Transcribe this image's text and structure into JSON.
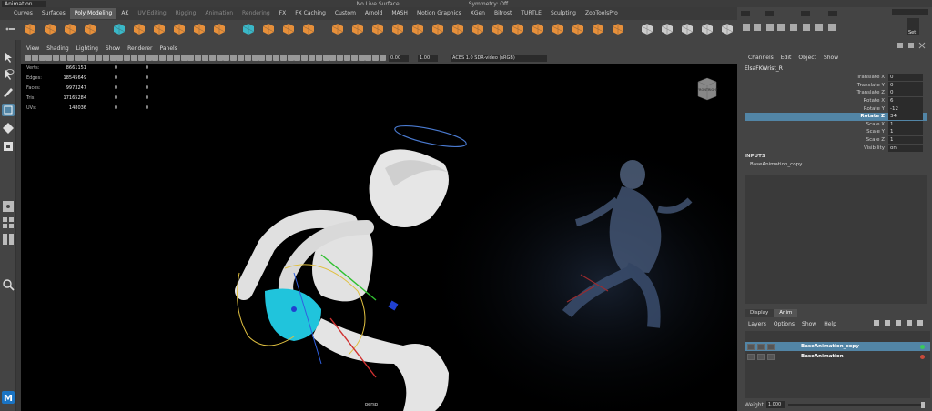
{
  "status_line": {
    "menu_set": "Animation",
    "live_surface": "No Live Surface",
    "symmetry": "Symmetry: Off"
  },
  "shelf_tabs": [
    {
      "label": "Curves",
      "active": false
    },
    {
      "label": "Surfaces",
      "active": false
    },
    {
      "label": "Poly Modeling",
      "active": true
    },
    {
      "label": "AK",
      "active": false
    },
    {
      "label": "UV Editing",
      "active": false,
      "dim": true
    },
    {
      "label": "Rigging",
      "active": false,
      "dim": true
    },
    {
      "label": "Animation",
      "active": false,
      "dim": true
    },
    {
      "label": "Rendering",
      "active": false,
      "dim": true
    },
    {
      "label": "FX",
      "active": false
    },
    {
      "label": "FX Caching",
      "active": false
    },
    {
      "label": "Custom",
      "active": false
    },
    {
      "label": "Arnold",
      "active": false
    },
    {
      "label": "MASH",
      "active": false
    },
    {
      "label": "Motion Graphics",
      "active": false
    },
    {
      "label": "XGen",
      "active": false
    },
    {
      "label": "Bifrost",
      "active": false
    },
    {
      "label": "TURTLE",
      "active": false
    },
    {
      "label": "Sculpting",
      "active": false
    },
    {
      "label": "ZooToolsPro",
      "active": false
    }
  ],
  "right_toolbar": {
    "set_label": "Set"
  },
  "viewport": {
    "menu": [
      "View",
      "Shading",
      "Lighting",
      "Show",
      "Renderer",
      "Panels"
    ],
    "field_a": "0.00",
    "field_b": "1.00",
    "color_management": "ACES 1.0 SDR-video (sRGB)",
    "camera": "persp",
    "hud": [
      {
        "label": "Verts:",
        "value": "8661151",
        "c1": "0",
        "c2": "0"
      },
      {
        "label": "Edges:",
        "value": "18545649",
        "c1": "0",
        "c2": "0"
      },
      {
        "label": "Faces:",
        "value": "9973247",
        "c1": "0",
        "c2": "0"
      },
      {
        "label": "Tris:",
        "value": "17165284",
        "c1": "0",
        "c2": "0"
      },
      {
        "label": "UVs:",
        "value": "148036",
        "c1": "0",
        "c2": "0"
      }
    ],
    "viewcube": {
      "face_a": "FRONT",
      "face_b": "RIGHT"
    }
  },
  "channel_box": {
    "menu": [
      "Channels",
      "Edit",
      "Object",
      "Show"
    ],
    "node": "ElsaFKWrist_R",
    "attributes": [
      {
        "label": "Translate X",
        "value": "0",
        "selected": false
      },
      {
        "label": "Translate Y",
        "value": "0",
        "selected": false
      },
      {
        "label": "Translate Z",
        "value": "0",
        "selected": false
      },
      {
        "label": "Rotate X",
        "value": "6",
        "selected": false
      },
      {
        "label": "Rotate Y",
        "value": "-12",
        "selected": false
      },
      {
        "label": "Rotate Z",
        "value": "34",
        "selected": true
      },
      {
        "label": "Scale X",
        "value": "1",
        "selected": false
      },
      {
        "label": "Scale Y",
        "value": "1",
        "selected": false
      },
      {
        "label": "Scale Z",
        "value": "1",
        "selected": false
      },
      {
        "label": "Visibility",
        "value": "on",
        "selected": false
      }
    ],
    "inputs_heading": "INPUTS",
    "input_node": "BaseAnimation_copy"
  },
  "layer_editor": {
    "tabs": [
      {
        "label": "Display",
        "active": false
      },
      {
        "label": "Anim",
        "active": true
      }
    ],
    "menu": [
      "Layers",
      "Options",
      "Show",
      "Help"
    ],
    "layers": [
      {
        "name": "BaseAnimation_copy",
        "selected": true
      },
      {
        "name": "BaseAnimation",
        "selected": false
      }
    ],
    "weight_label": "Weight",
    "weight_value": "1.000",
    "weight_level": 1.0
  },
  "colors": {
    "accent_blue": "#5285a6",
    "shelf_orange": "#e8903a",
    "shelf_teal": "#3ab8c8",
    "costume_cyan": "#22c8e0",
    "status_green": "#3ac85a"
  },
  "icons": [
    "select-tool-icon",
    "lasso-tool-icon",
    "paint-select-icon",
    "move-tool-icon",
    "rotate-tool-icon",
    "scale-tool-icon",
    "magnifier-icon",
    "maya-logo-icon"
  ]
}
